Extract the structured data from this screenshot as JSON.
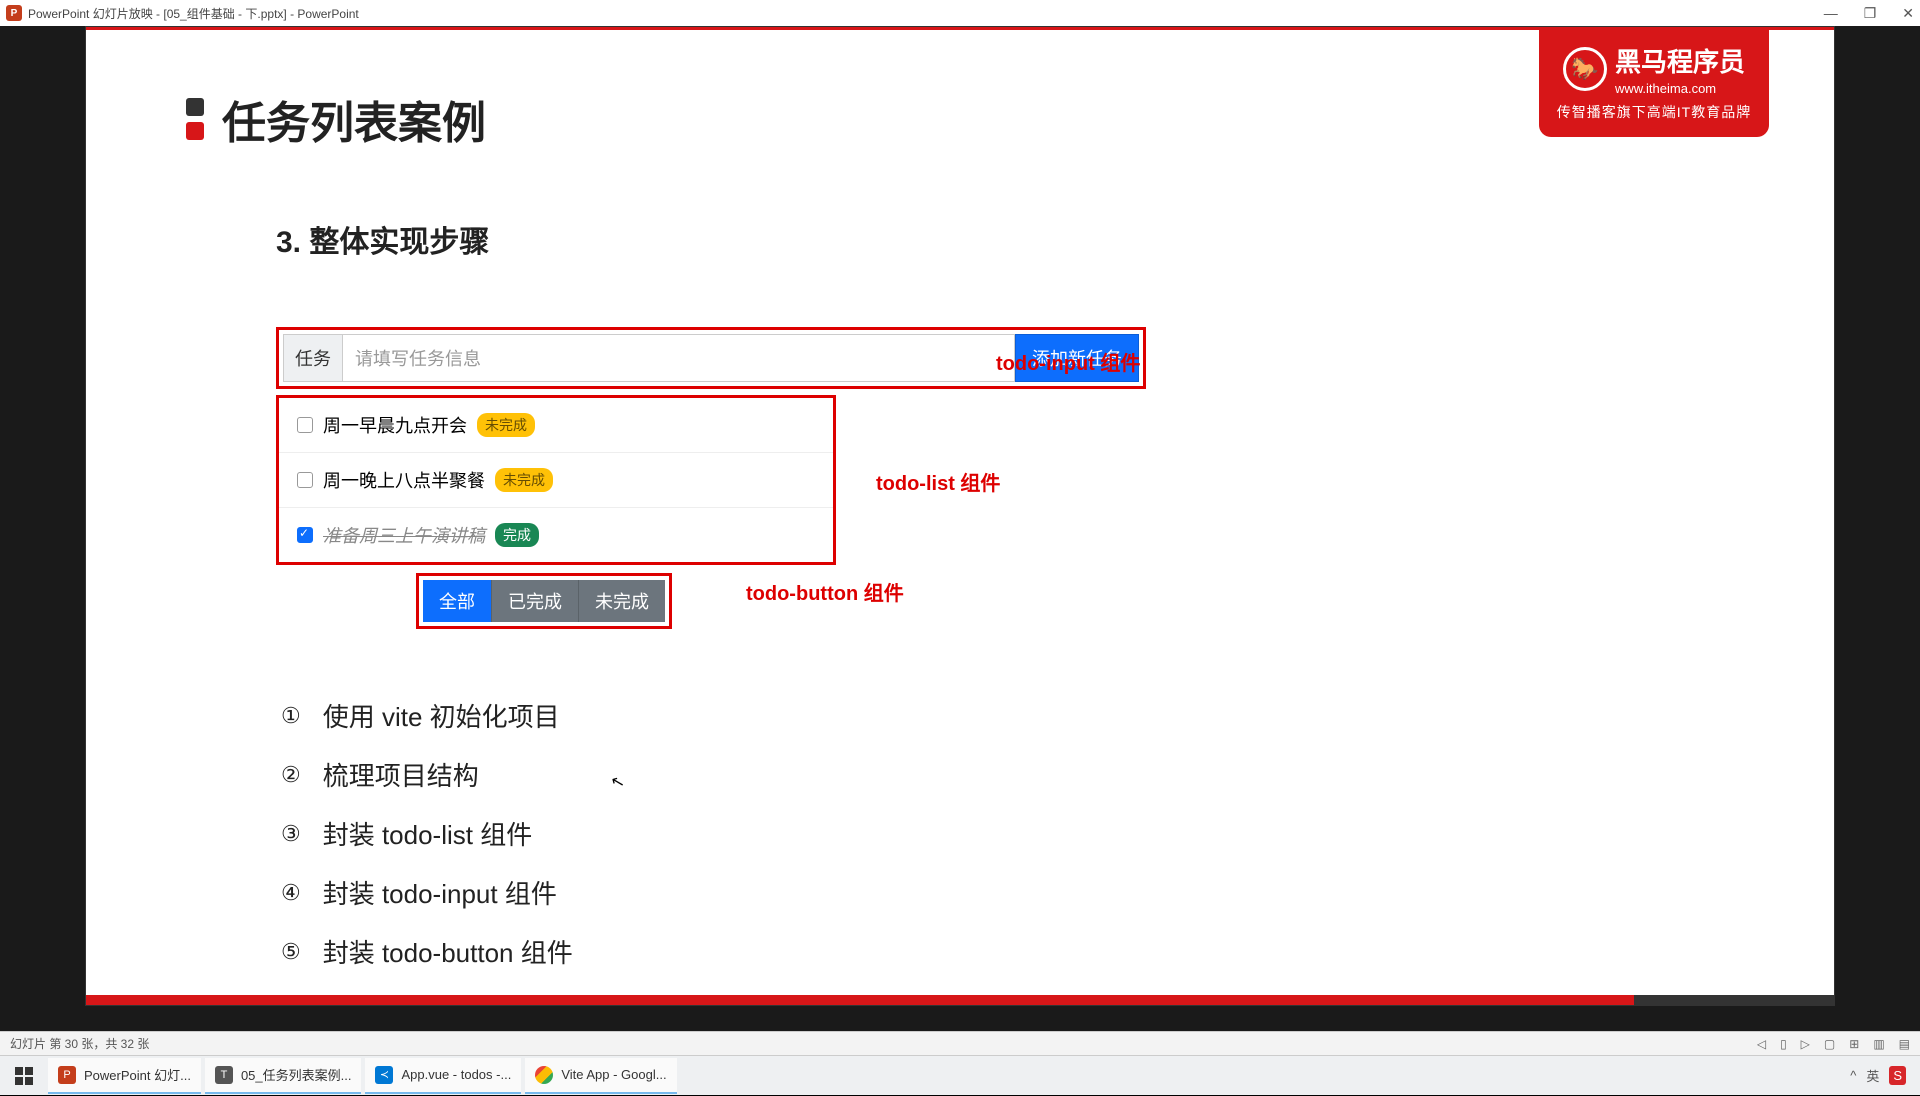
{
  "titlebar": {
    "title": "PowerPoint 幻灯片放映 - [05_组件基础 - 下.pptx] - PowerPoint",
    "min": "—",
    "max": "❐",
    "close": "✕"
  },
  "logo": {
    "name": "黑马程序员",
    "url": "www.itheima.com",
    "sub": "传智播客旗下高端IT教育品牌"
  },
  "slide": {
    "title": "任务列表案例",
    "subtitle": "3. 整体实现步骤",
    "input": {
      "label": "任务",
      "placeholder": "请填写任务信息",
      "button": "添加新任务"
    },
    "items": [
      {
        "text": "周一早晨九点开会",
        "done": false,
        "badge": "未完成"
      },
      {
        "text": "周一晚上八点半聚餐",
        "done": false,
        "badge": "未完成"
      },
      {
        "text": "准备周三上午演讲稿",
        "done": true,
        "badge": "完成"
      }
    ],
    "filters": {
      "all": "全部",
      "done": "已完成",
      "undone": "未完成"
    },
    "annotations": {
      "input": "todo-input 组件",
      "list": "todo-list 组件",
      "button": "todo-button 组件"
    },
    "steps": [
      "使用 vite 初始化项目",
      "梳理项目结构",
      "封装 todo-list 组件",
      "封装 todo-input 组件",
      "封装 todo-button 组件"
    ],
    "nums": [
      "①",
      "②",
      "③",
      "④",
      "⑤"
    ]
  },
  "status": {
    "slide_info": "幻灯片 第 30 张，共 32 张"
  },
  "taskbar": {
    "items": [
      {
        "icon_bg": "#c43e1c",
        "icon_txt": "P",
        "label": "PowerPoint 幻灯...",
        "active": true
      },
      {
        "icon_bg": "#555",
        "icon_txt": "T",
        "label": "05_任务列表案例...",
        "active": true
      },
      {
        "icon_bg": "#0078d4",
        "icon_txt": "⋔",
        "label": "App.vue - todos -...",
        "active": true
      },
      {
        "icon_bg": "#fff",
        "icon_txt": "",
        "label": "Vite App - Googl...",
        "active": true
      }
    ],
    "tray": {
      "caret": "^",
      "lang": "英",
      "ime": "S"
    }
  }
}
